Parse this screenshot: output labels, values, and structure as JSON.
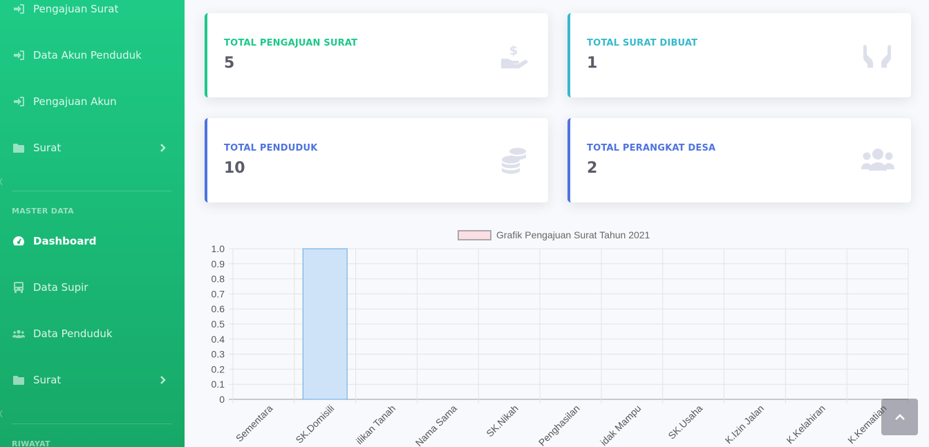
{
  "sidebar": {
    "items": [
      {
        "label": "Pengajuan Surat",
        "icon": "sign-in-icon"
      },
      {
        "label": "Data Akun Penduduk",
        "icon": "sign-in-icon"
      },
      {
        "label": "Pengajuan Akun",
        "icon": "sign-in-icon"
      },
      {
        "label": "Surat",
        "icon": "folder-icon"
      },
      {
        "label": "Dashboard",
        "icon": "tachometer-icon"
      },
      {
        "label": "Data Supir",
        "icon": "bus-icon"
      },
      {
        "label": "Data Penduduk",
        "icon": "users-icon"
      },
      {
        "label": "Surat",
        "icon": "folder-icon"
      }
    ],
    "headings": [
      "MASTER DATA",
      "RIWAYAT"
    ]
  },
  "cards": [
    {
      "label": "TOTAL PENGAJUAN SURAT",
      "value": "5",
      "color": "#1cc88a",
      "icon": "hand-holding-usd-icon"
    },
    {
      "label": "TOTAL SURAT DIBUAT",
      "value": "1",
      "color": "#36b9cc",
      "icon": "hands-icon"
    },
    {
      "label": "TOTAL PENDUDUK",
      "value": "10",
      "color": "#4e73df",
      "icon": "coins-icon"
    },
    {
      "label": "TOTAL PERANGKAT DESA",
      "value": "2",
      "color": "#4e73df",
      "icon": "users-icon"
    }
  ],
  "chart_data": {
    "type": "bar",
    "categories": [
      "Sementara",
      "SK.Domisili",
      "ilikan Tanah",
      "Nama Sama",
      "SK.Nikah",
      "Penghasilan",
      "idak Mampu",
      "SK.Usaha",
      "K.Izin Jalan",
      "K.Kelahiran",
      "K.Kematian"
    ],
    "series": [
      {
        "name": "Grafik Pengajuan Surat Tahun 2021",
        "values": [
          0,
          1,
          0,
          0,
          0,
          0,
          0,
          0,
          0,
          0,
          0
        ]
      }
    ],
    "ylim": [
      0,
      1.0
    ],
    "yticks": [
      "1.0",
      "0.9",
      "0.8",
      "0.7",
      "0.6",
      "0.5",
      "0.4",
      "0.3",
      "0.2",
      "0.1",
      "0"
    ],
    "grid": true,
    "legend": "top",
    "colors": {
      "legend_fill": "#fbdfe5",
      "bar_fill": "#cfe3f8",
      "bar_border": "#5fa8e0"
    }
  },
  "scroll_top": {
    "icon": "chevron-up-icon"
  }
}
